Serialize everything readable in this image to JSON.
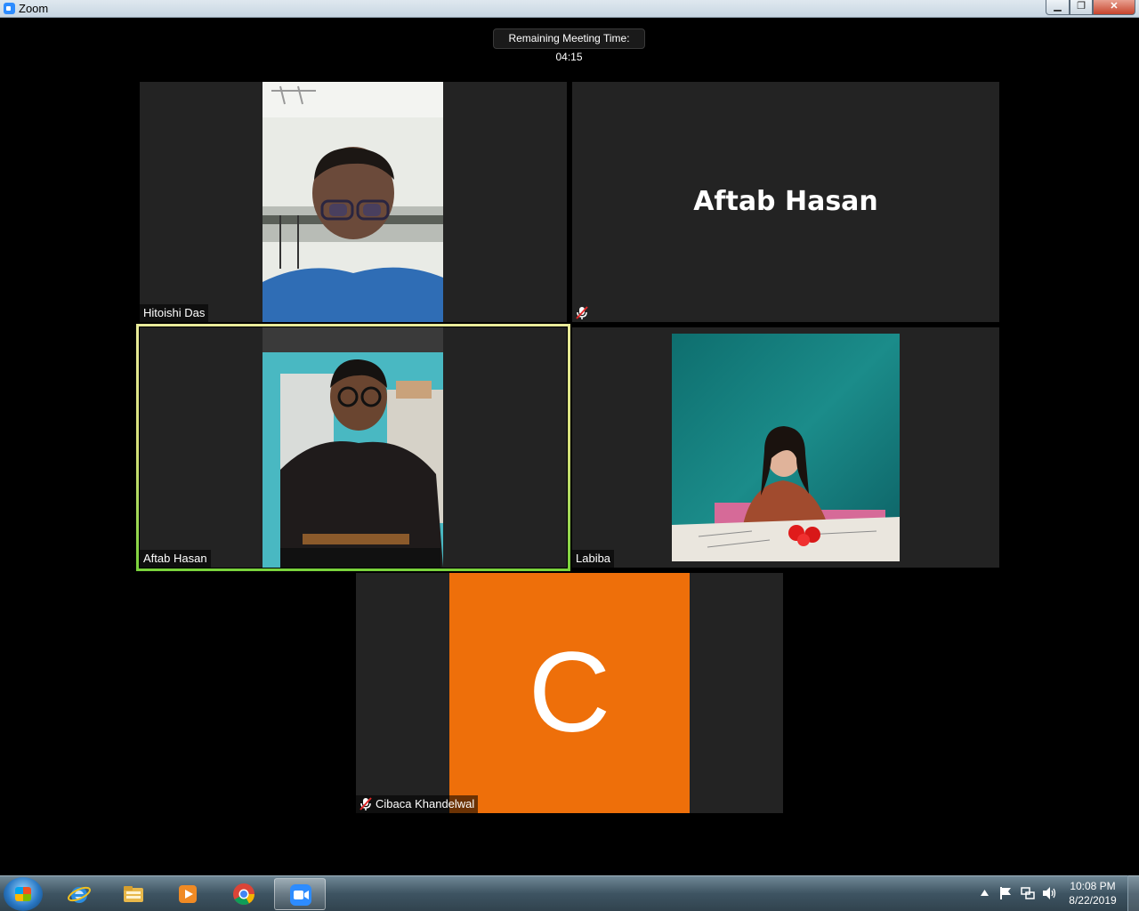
{
  "window": {
    "title": "Zoom",
    "minimize": "▁",
    "maximize": "❐",
    "close": "✕"
  },
  "meeting": {
    "timer_text": "Remaining Meeting Time: 04:15"
  },
  "participants": [
    {
      "name": "Hitoishi Das",
      "muted": false,
      "video": true
    },
    {
      "name": "Aftab Hasan",
      "muted": true,
      "video": false
    },
    {
      "name": "Aftab Hasan",
      "muted": false,
      "video": true,
      "active_speaker": true
    },
    {
      "name": "Labiba",
      "muted": false,
      "video": true
    },
    {
      "name": "Cibaca Khandelwal",
      "muted": true,
      "video": false,
      "avatar_letter": "C"
    }
  ],
  "colors": {
    "avatar_bg": "#ee6f0a",
    "active_border": "#d6e07a",
    "tile_bg": "#232323"
  },
  "taskbar": {
    "items": [
      "internet-explorer-icon",
      "file-explorer-icon",
      "media-player-icon",
      "chrome-icon",
      "zoom-icon"
    ],
    "clock_time": "10:08 PM",
    "clock_date": "8/22/2019"
  }
}
